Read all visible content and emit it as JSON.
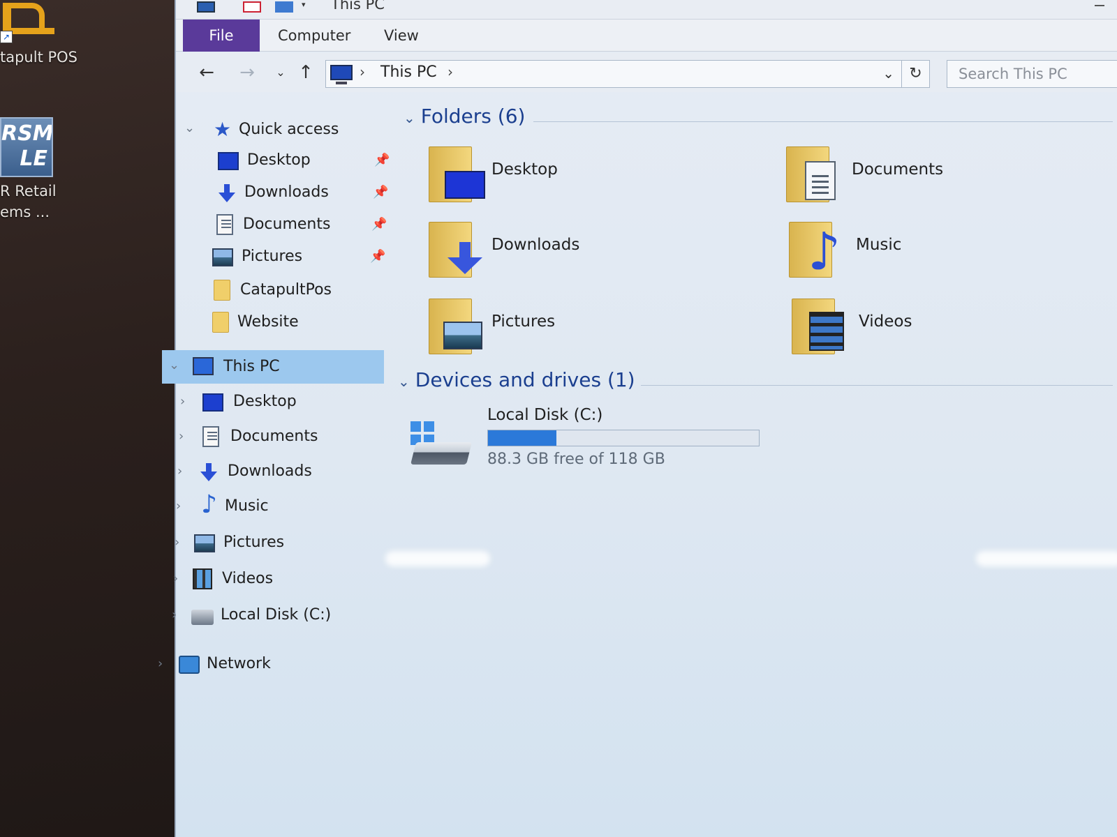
{
  "desktop": {
    "icons": [
      {
        "label_line1": "tapult POS",
        "label_line2": ""
      },
      {
        "logo_text": "RSM\nLE",
        "label_line1": "R Retail",
        "label_line2": "ems ..."
      }
    ]
  },
  "window": {
    "title": "This PC",
    "ribbon_tabs": [
      {
        "label": "File"
      },
      {
        "label": "Computer"
      },
      {
        "label": "View"
      }
    ],
    "nav_buttons": {
      "back": "←",
      "forward": "→",
      "recent": "⌄",
      "up": "↑"
    },
    "address": {
      "crumb": "This PC",
      "sep": "›",
      "dropdown": "⌄",
      "refresh": "↻"
    },
    "search": {
      "placeholder": "Search This PC"
    }
  },
  "nav_pane": {
    "quick_access": {
      "label": "Quick access",
      "items": [
        {
          "label": "Desktop",
          "icon": "desktop-icon",
          "pinned": true
        },
        {
          "label": "Downloads",
          "icon": "downloads-icon",
          "pinned": true
        },
        {
          "label": "Documents",
          "icon": "documents-icon",
          "pinned": true
        },
        {
          "label": "Pictures",
          "icon": "pictures-icon",
          "pinned": true
        },
        {
          "label": "CatapultPos",
          "icon": "folder-icon",
          "pinned": false
        },
        {
          "label": "Website",
          "icon": "folder-icon",
          "pinned": false
        }
      ]
    },
    "this_pc": {
      "label": "This PC",
      "items": [
        {
          "label": "Desktop",
          "icon": "desktop-icon"
        },
        {
          "label": "Documents",
          "icon": "documents-icon"
        },
        {
          "label": "Downloads",
          "icon": "downloads-icon"
        },
        {
          "label": "Music",
          "icon": "music-icon"
        },
        {
          "label": "Pictures",
          "icon": "pictures-icon"
        },
        {
          "label": "Videos",
          "icon": "videos-icon"
        },
        {
          "label": "Local Disk (C:)",
          "icon": "drive-icon"
        }
      ]
    },
    "network": {
      "label": "Network"
    },
    "chevron_open": "⌄",
    "chevron_closed": "›",
    "pin_glyph": "📌"
  },
  "content": {
    "folders_header": "Folders (6)",
    "folders": [
      {
        "label": "Desktop",
        "icon": "desktop-folder-icon"
      },
      {
        "label": "Documents",
        "icon": "documents-folder-icon"
      },
      {
        "label": "Downloads",
        "icon": "downloads-folder-icon"
      },
      {
        "label": "Music",
        "icon": "music-folder-icon"
      },
      {
        "label": "Pictures",
        "icon": "pictures-folder-icon"
      },
      {
        "label": "Videos",
        "icon": "videos-folder-icon"
      }
    ],
    "devices_header": "Devices and drives (1)",
    "drives": [
      {
        "name": "Local Disk (C:)",
        "free_text": "88.3 GB free of 118 GB",
        "used_fraction": 0.252
      }
    ]
  },
  "colors": {
    "file_tab": "#5a3a9a",
    "selection": "#9cc8ee",
    "drive_fill": "#2b79d9",
    "group_header": "#1b3f8f"
  }
}
